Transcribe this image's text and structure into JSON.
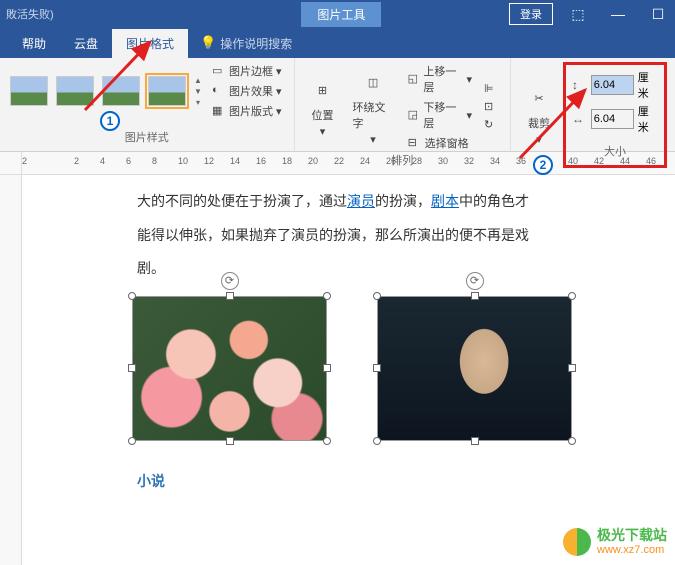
{
  "titlebar": {
    "left_text": "敗活失败)",
    "pic_tools": "图片工具",
    "login": "登录"
  },
  "tabs": {
    "help": "帮助",
    "cloud": "云盘",
    "pic_format": "图片格式",
    "tellme": "操作说明搜索"
  },
  "ribbon": {
    "group_styles": "图片样式",
    "pic_border": "图片边框",
    "pic_effect": "图片效果",
    "pic_layout": "图片版式",
    "position": "位置",
    "wrap": "环绕文字",
    "group_arrange": "排列",
    "bring_fwd": "上移一层",
    "send_back": "下移一层",
    "sel_pane": "选择窗格",
    "crop": "裁剪",
    "group_size": "大小",
    "height": "6.04",
    "width": "6.04",
    "unit": "厘米"
  },
  "ruler": {
    "marks": [
      "2",
      "",
      "2",
      "4",
      "6",
      "8",
      "10",
      "12",
      "14",
      "16",
      "18",
      "20",
      "22",
      "24",
      "26",
      "28",
      "30",
      "32",
      "34",
      "36",
      "",
      "40",
      "42",
      "44",
      "46"
    ]
  },
  "doc": {
    "line1": "大的不同的处便在于扮演了，通过",
    "link1": "演员",
    "line1b": "的扮演，",
    "link2": "剧本",
    "line1c": "中的角色才",
    "line2": "能得以伸张，如果抛弃了演员的扮演，那么所演出的便不再是戏",
    "line3": "剧。",
    "section": "小说"
  },
  "watermark": {
    "name": "极光下载站",
    "url": "www.xz7.com"
  }
}
